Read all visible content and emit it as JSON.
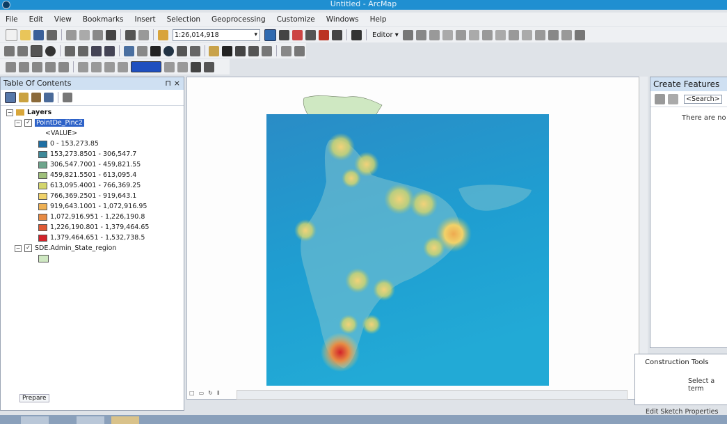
{
  "window": {
    "title": "Untitled - ArcMap"
  },
  "menu": [
    "File",
    "Edit",
    "View",
    "Bookmarks",
    "Insert",
    "Selection",
    "Geoprocessing",
    "Customize",
    "Windows",
    "Help"
  ],
  "toolbar": {
    "scale": "1:26,014,918",
    "editor_label": "Editor ▾"
  },
  "toc": {
    "title": "Table Of Contents",
    "pin": "⊓",
    "close": "×",
    "layers_label": "Layers",
    "layer1": "PointDe_Pinc2",
    "value_label": "<VALUE>",
    "legend": [
      {
        "label": "0 - 153,273.85",
        "color": "#1f6fa3"
      },
      {
        "label": "153,273.8501 - 306,547.7",
        "color": "#3f8a9a"
      },
      {
        "label": "306,547.7001 - 459,821.55",
        "color": "#6da58c"
      },
      {
        "label": "459,821.5501 - 613,095.4",
        "color": "#9fc07b"
      },
      {
        "label": "613,095.4001 - 766,369.25",
        "color": "#d3d56c"
      },
      {
        "label": "766,369.2501 - 919,643.1",
        "color": "#f0d26a"
      },
      {
        "label": "919,643.1001 - 1,072,916.95",
        "color": "#eeb054"
      },
      {
        "label": "1,072,916.951 - 1,226,190.8",
        "color": "#e78a43"
      },
      {
        "label": "1,226,190.801 - 1,379,464.65",
        "color": "#df5a35"
      },
      {
        "label": "1,379,464.651 - 1,532,738.5",
        "color": "#d2232a"
      }
    ],
    "layer2": "SDE.Admin_State_region"
  },
  "create_features": {
    "title": "Create Features",
    "search": "<Search>",
    "message": "There are no"
  },
  "construction_tools": {
    "title": "Construction Tools",
    "message": "Select a term"
  },
  "sketch_properties": "Edit Sketch Properties",
  "prepare": "Prepare",
  "colors": {
    "titlebar": "#1f8fd1",
    "selection": "#2d62c8",
    "raster_blue": "#1f9ed1"
  }
}
